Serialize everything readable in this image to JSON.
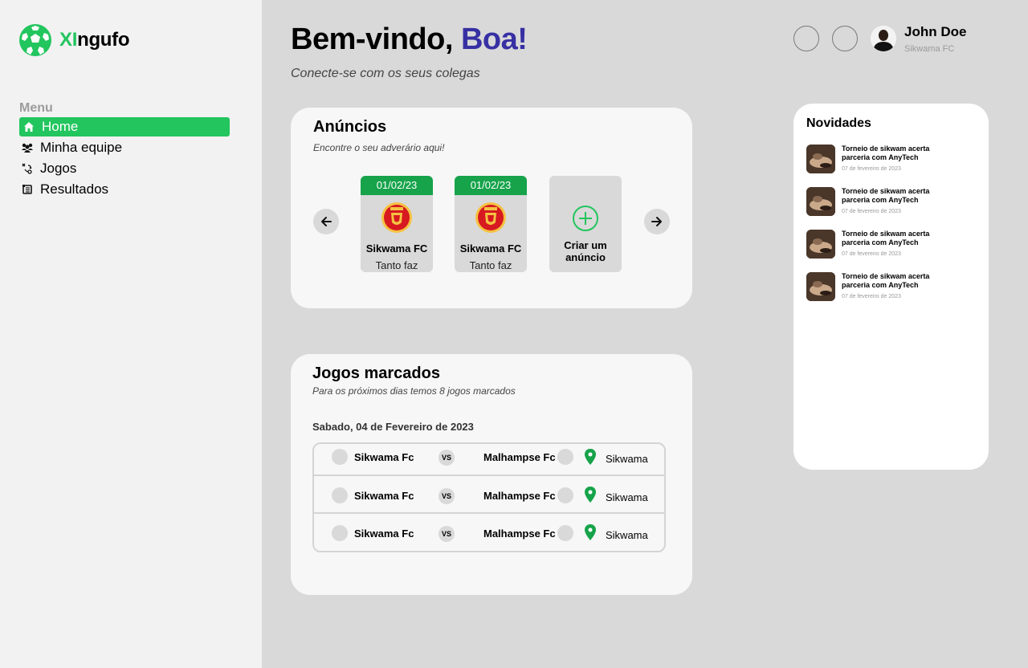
{
  "app": {
    "logo_part1": "XI",
    "logo_part2": "ngufo"
  },
  "sidebar": {
    "menu_heading": "Menu",
    "items": [
      {
        "label": "Home",
        "icon": "home-icon",
        "active": true
      },
      {
        "label": "Minha equipe",
        "icon": "team-icon"
      },
      {
        "label": "Jogos",
        "icon": "tactics-icon"
      },
      {
        "label": "Resultados",
        "icon": "scroll-icon"
      }
    ]
  },
  "header": {
    "greeting": "Bem-vindo,",
    "greeting_highlight": "Boa!",
    "subtitle": "Conecte-se com os seus colegas",
    "user_name": "John Doe",
    "user_team": "Sikwama FC"
  },
  "ads": {
    "title": "Anúncios",
    "subtitle": "Encontre o seu adverário aqui!",
    "items": [
      {
        "date": "01/02/23",
        "team": "Sikwama FC",
        "note": "Tanto faz"
      },
      {
        "date": "01/02/23",
        "team": "Sikwama FC",
        "note": "Tanto faz"
      }
    ],
    "create_label_line1": "Criar um",
    "create_label_line2": "anúncio"
  },
  "games": {
    "title": "Jogos marcados",
    "subtitle": "Para os próximos dias temos 8 jogos marcados",
    "date_heading": "Sabado, 04 de Fevereiro de 2023",
    "vs_label": "VS",
    "rows": [
      {
        "home": "Sikwama Fc",
        "away": "Malhampse Fc",
        "place": "Sikwama"
      },
      {
        "home": "Sikwama Fc",
        "away": "Malhampse Fc",
        "place": "Sikwama"
      },
      {
        "home": "Sikwama Fc",
        "away": "Malhampse Fc",
        "place": "Sikwama"
      }
    ]
  },
  "news": {
    "title": "Novidades",
    "items": [
      {
        "headline": "Torneio de sikwam acerta parceria com AnyTech",
        "date": "07 de fevereiro de  2023"
      },
      {
        "headline": "Torneio de sikwam acerta parceria com AnyTech",
        "date": "07 de fevereiro de  2023"
      },
      {
        "headline": "Torneio de sikwam acerta parceria com AnyTech",
        "date": "07 de fevereiro de  2023"
      },
      {
        "headline": "Torneio de sikwam acerta parceria com AnyTech",
        "date": "07 de fevereiro de  2023"
      }
    ]
  },
  "colors": {
    "accent": "#22c55e",
    "accent_dark": "#16a34a",
    "highlight": "#3730a3"
  }
}
